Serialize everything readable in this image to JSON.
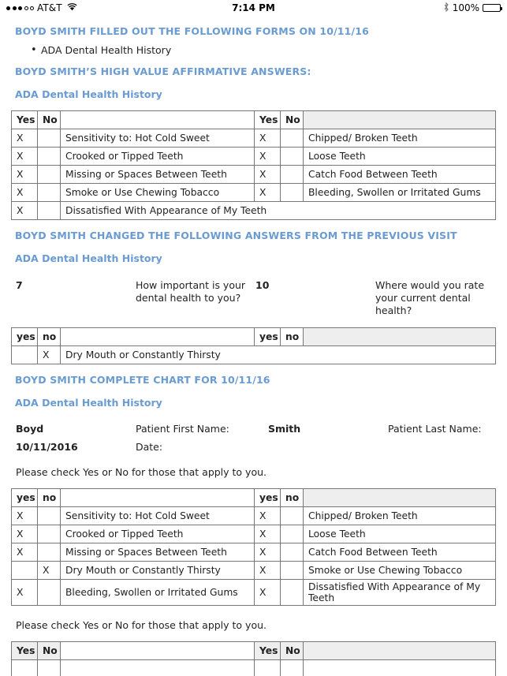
{
  "statusbar": {
    "carrier": "AT&T",
    "time": "7:14 PM",
    "battery_percent": "100%",
    "signal_filled": 3,
    "signal_hollow": 2
  },
  "filled_forms": {
    "heading": "BOYD SMITH FILLED OUT THE FOLLOWING FORMS ON 10/11/16",
    "items": [
      "ADA Dental Health History"
    ]
  },
  "high_value": {
    "heading": "BOYD SMITH’S HIGH VALUE AFFIRMATIVE ANSWERS:",
    "subheading": "ADA Dental Health History",
    "table": {
      "headers": {
        "yes": "Yes",
        "no": "No",
        "label": "",
        "yes2": "Yes",
        "no2": "No",
        "label2": ""
      },
      "rows": [
        {
          "yes": "X",
          "no": "",
          "label": "Sensitivity to: Hot Cold Sweet",
          "yes2": "X",
          "no2": "",
          "label2": "Chipped/ Broken Teeth"
        },
        {
          "yes": "X",
          "no": "",
          "label": "Crooked or Tipped Teeth",
          "yes2": "X",
          "no2": "",
          "label2": "Loose Teeth"
        },
        {
          "yes": "X",
          "no": "",
          "label": "Missing or Spaces Between Teeth",
          "yes2": "X",
          "no2": "",
          "label2": "Catch Food Between Teeth"
        },
        {
          "yes": "X",
          "no": "",
          "label": "Smoke or Use Chewing Tobacco",
          "yes2": "X",
          "no2": "",
          "label2": "Bleeding, Swollen or Irritated Gums"
        }
      ],
      "last_row": {
        "yes": "X",
        "no": "",
        "label": "Dissatisfied With Appearance of My Teeth"
      }
    }
  },
  "changed": {
    "heading": "BOYD SMITH CHANGED THE FOLLOWING ANSWERS FROM THE PREVIOUS VISIT",
    "subheading": "ADA Dental Health History",
    "answers": [
      {
        "value": "7",
        "question": "How important is your dental health to you?"
      },
      {
        "value": "10",
        "question": "Where would you rate your current dental health?"
      }
    ],
    "table": {
      "headers": {
        "yes": "yes",
        "no": "no",
        "label": "",
        "yes2": "yes",
        "no2": "no",
        "label2": ""
      },
      "rows": [
        {
          "yes": "",
          "no": "X",
          "label": "Dry Mouth or Constantly Thirsty"
        }
      ]
    }
  },
  "complete": {
    "heading": "BOYD SMITH COMPLETE CHART FOR 10/11/16",
    "subheading": "ADA Dental Health History",
    "patient": {
      "first_name_value": "Boyd",
      "first_name_label": "Patient First Name:",
      "last_name_value": "Smith",
      "last_name_label": "Patient Last Name:",
      "date_value": "10/11/2016",
      "date_label": "Date:"
    },
    "instruction": "Please check Yes or No for those that apply to you.",
    "table": {
      "headers": {
        "yes": "yes",
        "no": "no",
        "label": "",
        "yes2": "yes",
        "no2": "no",
        "label2": ""
      },
      "rows": [
        {
          "yes": "X",
          "no": "",
          "label": "Sensitivity to: Hot Cold Sweet",
          "yes2": "X",
          "no2": "",
          "label2": "Chipped/ Broken Teeth"
        },
        {
          "yes": "X",
          "no": "",
          "label": "Crooked or Tipped Teeth",
          "yes2": "X",
          "no2": "",
          "label2": "Loose Teeth"
        },
        {
          "yes": "X",
          "no": "",
          "label": "Missing or Spaces Between Teeth",
          "yes2": "X",
          "no2": "",
          "label2": "Catch Food Between Teeth"
        },
        {
          "yes": "",
          "no": "X",
          "label": "Dry Mouth or Constantly Thirsty",
          "yes2": "X",
          "no2": "",
          "label2": "Smoke or Use Chewing Tobacco"
        },
        {
          "yes": "X",
          "no": "",
          "label": "Bleeding, Swollen or Irritated Gums",
          "yes2": "X",
          "no2": "",
          "label2": "Dissatisfied With Appearance of My Teeth"
        }
      ]
    },
    "instruction2": "Please check Yes or No for those that apply to you.",
    "table2": {
      "headers": {
        "yes": "Yes",
        "no": "No",
        "label": "",
        "yes2": "Yes",
        "no2": "No",
        "label2": ""
      }
    }
  }
}
